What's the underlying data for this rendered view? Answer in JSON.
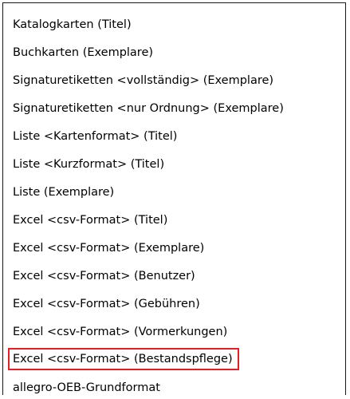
{
  "menu": {
    "highlight_color": "#e41f26",
    "items": [
      {
        "label": "Katalogkarten (Titel)"
      },
      {
        "label": "Buchkarten (Exemplare)"
      },
      {
        "label": "Signaturetiketten <vollständig> (Exemplare)"
      },
      {
        "label": "Signaturetiketten <nur Ordnung> (Exemplare)"
      },
      {
        "label": "Liste <Kartenformat> (Titel)"
      },
      {
        "label": "Liste <Kurzformat> (Titel)"
      },
      {
        "label": "Liste (Exemplare)"
      },
      {
        "label": "Excel <csv-Format> (Titel)"
      },
      {
        "label": "Excel <csv-Format> (Exemplare)"
      },
      {
        "label": "Excel <csv-Format> (Benutzer)"
      },
      {
        "label": "Excel <csv-Format> (Gebühren)"
      },
      {
        "label": "Excel <csv-Format> (Vormerkungen)"
      },
      {
        "label": "Excel <csv-Format> (Bestandspflege)",
        "highlighted": true
      },
      {
        "label": "allegro-OEB-Grundformat"
      }
    ]
  }
}
